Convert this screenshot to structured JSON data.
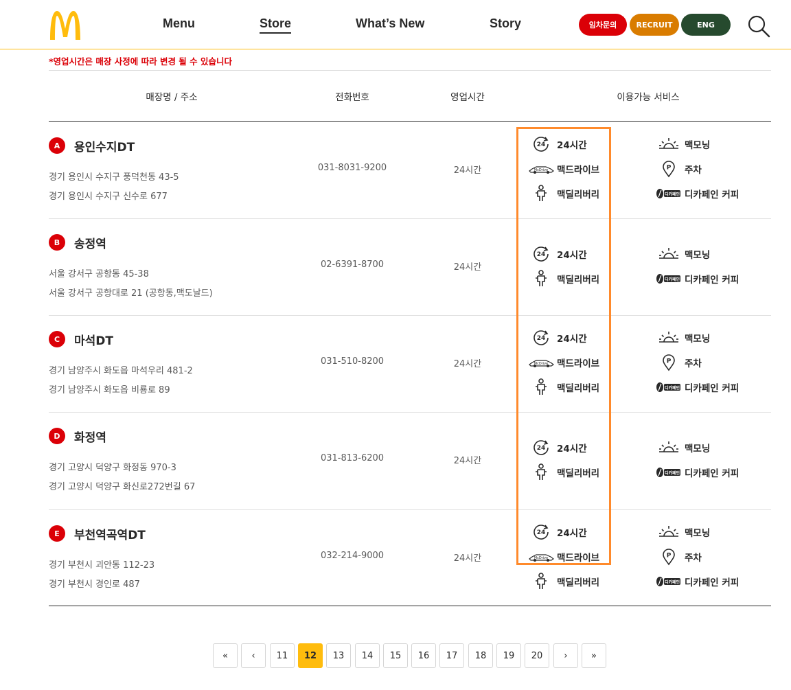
{
  "header": {
    "nav": [
      "Menu",
      "Store",
      "What’s New",
      "Story"
    ],
    "active_nav": "Store",
    "buttons": {
      "leasing": "임차문의",
      "recruit": "RECRUIT",
      "eng": "ENG"
    },
    "colors": {
      "leasing": "#db0007",
      "recruit": "#d97c00",
      "eng": "#264a2e",
      "brand_yellow": "#ffbc0d"
    },
    "search_icon": "search-icon",
    "logo": "mcdonalds-golden-arches"
  },
  "notice": "*영업시간은 매장 사정에 따라 변경 될 수 있습니다",
  "table": {
    "headers": [
      "매장명 / 주소",
      "전화번호",
      "영업시간",
      "이용가능 서비스"
    ],
    "rows": [
      {
        "letter": "A",
        "name": "용인수지DT",
        "address1": "경기 용인시 수지구 풍덕천동 43-5",
        "address2": "경기 용인시 수지구 신수로 677",
        "phone": "031-8031-9200",
        "hours": "24시간",
        "left_services": [
          "24시간",
          "맥드라이브",
          "맥딜리버리"
        ],
        "right_services": [
          "맥모닝",
          "주차",
          "디카페인 커피"
        ]
      },
      {
        "letter": "B",
        "name": "송정역",
        "address1": "서울 강서구 공항동 45-38",
        "address2": "서울 강서구 공항대로 21 (공항동,맥도날드)",
        "phone": "02-6391-8700",
        "hours": "24시간",
        "left_services": [
          "24시간",
          "맥딜리버리"
        ],
        "right_services": [
          "맥모닝",
          "디카페인 커피"
        ]
      },
      {
        "letter": "C",
        "name": "마석DT",
        "address1": "경기 남양주시 화도읍 마석우리 481-2",
        "address2": "경기 남양주시 화도읍 비룡로 89",
        "phone": "031-510-8200",
        "hours": "24시간",
        "left_services": [
          "24시간",
          "맥드라이브",
          "맥딜리버리"
        ],
        "right_services": [
          "맥모닝",
          "주차",
          "디카페인 커피"
        ]
      },
      {
        "letter": "D",
        "name": "화정역",
        "address1": "경기 고양시 덕양구 화정동 970-3",
        "address2": "경기 고양시 덕양구 화신로272번길 67",
        "phone": "031-813-6200",
        "hours": "24시간",
        "left_services": [
          "24시간",
          "맥딜리버리"
        ],
        "right_services": [
          "맥모닝",
          "디카페인 커피"
        ]
      },
      {
        "letter": "E",
        "name": "부천역곡역DT",
        "address1": "경기 부천시 괴안동 112-23",
        "address2": "경기 부천시 경인로 487",
        "phone": "032-214-9000",
        "hours": "24시간",
        "left_services": [
          "24시간",
          "맥드라이브",
          "맥딜리버리"
        ],
        "right_services": [
          "맥모닝",
          "주차",
          "디카페인 커피"
        ]
      }
    ]
  },
  "service_icons": {
    "24시간": "clock-24-icon",
    "맥드라이브": "mcdrive-car-icon",
    "맥딜리버리": "delivery-scooter-icon",
    "맥모닝": "sunrise-icon",
    "주차": "parking-pin-icon",
    "디카페인 커피": "decaf-coffee-icon"
  },
  "pagination": {
    "first": "«",
    "prev": "‹",
    "pages": [
      "11",
      "12",
      "13",
      "14",
      "15",
      "16",
      "17",
      "18",
      "19",
      "20"
    ],
    "current": "12",
    "next": "›",
    "last": "»"
  }
}
